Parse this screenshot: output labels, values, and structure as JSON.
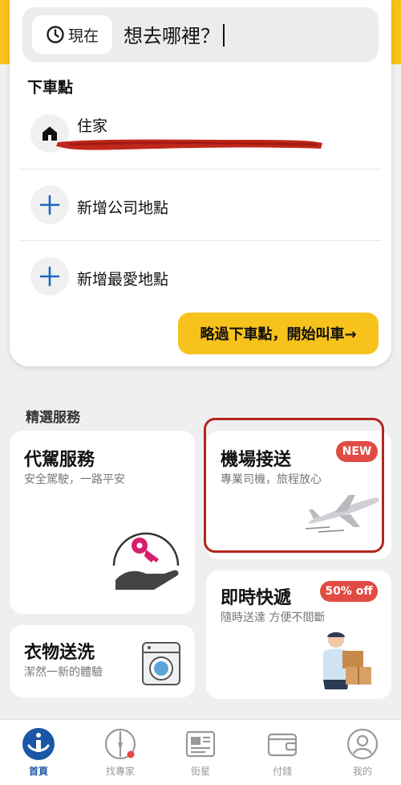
{
  "search": {
    "time_label": "現在",
    "prompt": "想去哪裡？"
  },
  "dropoff": {
    "title": "下車點",
    "home_label": "住家",
    "add_work_label": "新增公司地點",
    "add_favorite_label": "新增最愛地點",
    "skip_label": "略過下車點，開始叫車→"
  },
  "services": {
    "title": "精選服務",
    "designated_driver": {
      "title": "代駕服務",
      "subtitle": "安全駕駛，一路平安"
    },
    "airport": {
      "title": "機場接送",
      "subtitle": "專業司機，旅程放心",
      "badge": "NEW"
    },
    "laundry": {
      "title": "衣物送洗",
      "subtitle": "潔然一新的體驗"
    },
    "courier": {
      "title": "即時快遞",
      "subtitle": "隨時送達 方便不間斷",
      "badge": "50% off"
    }
  },
  "nav": [
    {
      "label": "首頁",
      "icon": "home-icon",
      "active": true
    },
    {
      "label": "找專家",
      "icon": "expert-icon",
      "active": false
    },
    {
      "label": "街星",
      "icon": "news-icon",
      "active": false
    },
    {
      "label": "付錢",
      "icon": "wallet-icon",
      "active": false
    },
    {
      "label": "我的",
      "icon": "profile-icon",
      "active": false
    }
  ],
  "colors": {
    "brand_yellow": "#f7c21b",
    "badge_red": "#e14b43",
    "active_blue": "#1a57a6",
    "annotation_red": "#b3261e"
  }
}
